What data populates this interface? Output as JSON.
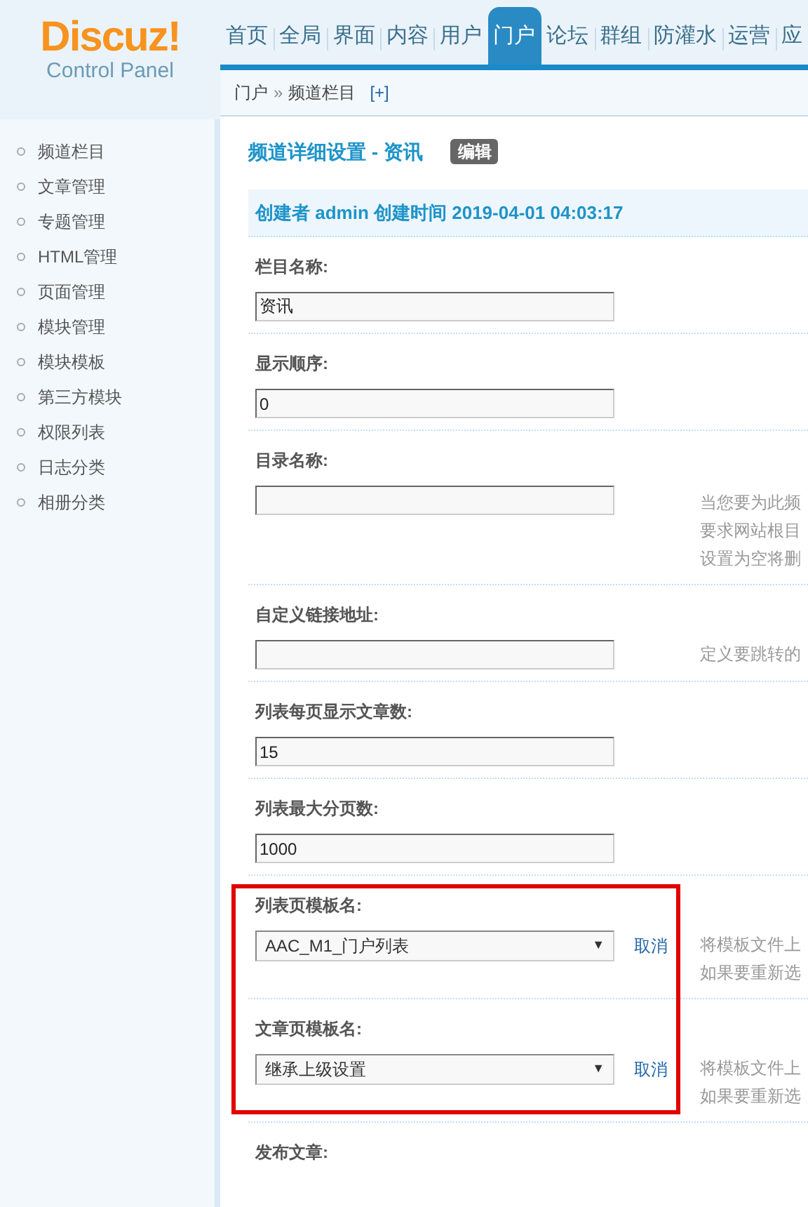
{
  "logo": {
    "title": "Discuz!",
    "subtitle": "Control Panel"
  },
  "nav": [
    {
      "label": "首页",
      "selected": false
    },
    {
      "label": "全局",
      "selected": false
    },
    {
      "label": "界面",
      "selected": false
    },
    {
      "label": "内容",
      "selected": false
    },
    {
      "label": "用户",
      "selected": false
    },
    {
      "label": "门户",
      "selected": true
    },
    {
      "label": "论坛",
      "selected": false
    },
    {
      "label": "群组",
      "selected": false
    },
    {
      "label": "防灌水",
      "selected": false
    },
    {
      "label": "运营",
      "selected": false
    },
    {
      "label": "应",
      "selected": false
    }
  ],
  "breadcrumb": {
    "parts": [
      "门户",
      "»",
      "频道栏目"
    ],
    "add": "[+]"
  },
  "sidebar": {
    "items": [
      {
        "label": "频道栏目"
      },
      {
        "label": "文章管理"
      },
      {
        "label": "专题管理"
      },
      {
        "label": "HTML管理"
      },
      {
        "label": "页面管理"
      },
      {
        "label": "模块管理"
      },
      {
        "label": "模块模板"
      },
      {
        "label": "第三方模块"
      },
      {
        "label": "权限列表"
      },
      {
        "label": "日志分类"
      },
      {
        "label": "相册分类"
      }
    ]
  },
  "page_title": "频道详细设置 - 资讯",
  "edit_badge": "编辑",
  "info_bar": "创建者 admin 创建时间 2019-04-01 04:03:17",
  "rows": [
    {
      "kind": "text",
      "label": "栏目名称:",
      "value": "资讯",
      "highlighted": false
    },
    {
      "kind": "text",
      "label": "显示顺序:",
      "value": "0",
      "highlighted": false
    },
    {
      "kind": "text",
      "label": "目录名称:",
      "value": "",
      "hint": [
        "当您要为此频",
        "要求网站根目",
        "设置为空将删"
      ],
      "highlighted": false
    },
    {
      "kind": "text",
      "label": "自定义链接地址:",
      "value": "",
      "hint": [
        "定义要跳转的"
      ],
      "highlighted": false
    },
    {
      "kind": "text",
      "label": "列表每页显示文章数:",
      "value": "15",
      "highlighted": false
    },
    {
      "kind": "text",
      "label": "列表最大分页数:",
      "value": "1000",
      "highlighted": false
    },
    {
      "kind": "select",
      "label": "列表页模板名:",
      "value": "AAC_M1_门户列表",
      "caret": "▼",
      "cancel": "取消",
      "hint": [
        "将模板文件上",
        "如果要重新选"
      ],
      "highlighted": true
    },
    {
      "kind": "select",
      "label": "文章页模板名:",
      "value": "继承上级设置",
      "caret": "▼",
      "cancel": "取消",
      "hint": [
        "将模板文件上",
        "如果要重新选"
      ],
      "highlighted": true
    },
    {
      "kind": "heading",
      "label": "发布文章:",
      "highlighted": false
    }
  ]
}
